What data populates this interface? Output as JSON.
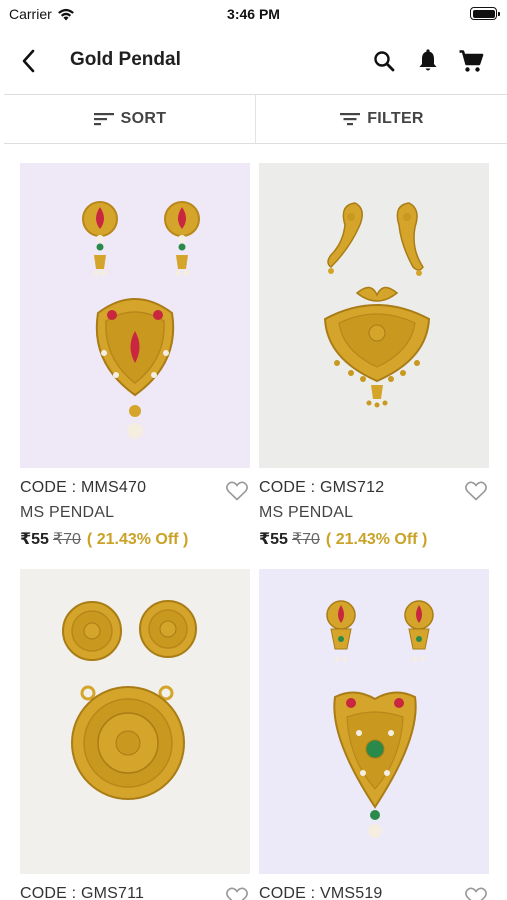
{
  "status_bar": {
    "carrier": "Carrier",
    "time": "3:46 PM"
  },
  "header": {
    "title": "Gold Pendal"
  },
  "toolbar": {
    "sort_label": "SORT",
    "filter_label": "FILTER"
  },
  "products": [
    {
      "code": "CODE : MMS470",
      "category": "MS PENDAL",
      "price": "₹55",
      "mrp": "₹70",
      "discount": "( 21.43% Off )"
    },
    {
      "code": "CODE : GMS712",
      "category": "MS PENDAL",
      "price": "₹55",
      "mrp": "₹70",
      "discount": "( 21.43% Off )"
    },
    {
      "code": "CODE : GMS711"
    },
    {
      "code": "CODE : VMS519"
    }
  ],
  "colors": {
    "discount": "#c9a227",
    "card_bg_purple": "#eee8f7",
    "card_bg_white": "#ececea",
    "gold": "#d4a52a"
  }
}
